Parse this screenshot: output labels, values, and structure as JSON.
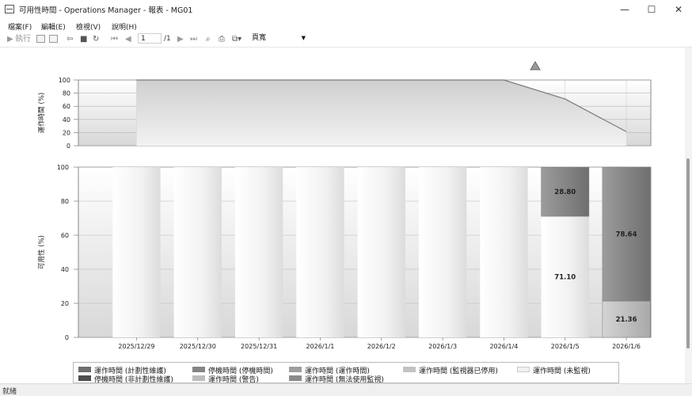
{
  "window": {
    "title": "可用性時間 - Operations Manager - 報表 - MG01",
    "minimize": "—",
    "maximize": "☐",
    "close": "✕"
  },
  "menu": {
    "items": [
      "檔案(F)",
      "編輯(E)",
      "檢視(V)",
      "說明(H)"
    ]
  },
  "toolbar": {
    "run_label": "執行",
    "page_current": "1",
    "page_total": "/1",
    "zoom": "頁寬"
  },
  "status": {
    "text": "就緒"
  },
  "chart_data": [
    {
      "type": "area",
      "ylabel": "運作時間 (%)",
      "ylim": [
        0,
        100
      ],
      "yticks": [
        0,
        20,
        40,
        60,
        80,
        100
      ],
      "x": [
        "2025/12/29",
        "2025/12/30",
        "2025/12/31",
        "2026/1/1",
        "2026/1/2",
        "2026/1/3",
        "2026/1/4",
        "2026/1/5",
        "2026/1/6"
      ],
      "values": [
        100,
        100,
        100,
        100,
        100,
        100,
        100,
        71.1,
        21.36
      ],
      "grid": true
    },
    {
      "type": "bar",
      "stacked": true,
      "ylabel": "可用性 (%)",
      "ylim": [
        0,
        100
      ],
      "yticks": [
        0,
        20,
        40,
        60,
        80,
        100
      ],
      "categories": [
        "2025/12/29",
        "2025/12/30",
        "2025/12/31",
        "2026/1/1",
        "2026/1/2",
        "2026/1/3",
        "2026/1/4",
        "2026/1/5",
        "2026/1/6"
      ],
      "series": [
        {
          "name": "運作時間 (運作時間)",
          "color": "#c2c2c2",
          "values": [
            0,
            0,
            0,
            0,
            0,
            0,
            0,
            0,
            21.36
          ],
          "labels": [
            "",
            "",
            "",
            "",
            "",
            "",
            "",
            "",
            "21.36"
          ]
        },
        {
          "name": "運作時間 (未監視)",
          "color": "#f5f5f5",
          "values": [
            100,
            100,
            100,
            100,
            100,
            100,
            100,
            71.1,
            0
          ],
          "labels": [
            "",
            "",
            "",
            "",
            "",
            "",
            "",
            "71.10",
            ""
          ]
        },
        {
          "name": "停機時間 (停機時間)",
          "color": "#858585",
          "values": [
            0,
            0,
            0,
            0,
            0,
            0,
            0,
            28.8,
            78.64
          ],
          "labels": [
            "",
            "",
            "",
            "",
            "",
            "",
            "",
            "28.80",
            "78.64"
          ]
        }
      ],
      "grid": true,
      "legend_position": "bottom"
    }
  ],
  "legend": [
    {
      "label": "運作時間 (計劃性維護)",
      "color": "#6e6e6e"
    },
    {
      "label": "停機時間 (停機時間)",
      "color": "#858585"
    },
    {
      "label": "運作時間 (運作時間)",
      "color": "#9e9e9e"
    },
    {
      "label": "運作時間 (監視器已停用)",
      "color": "#c2c2c2"
    },
    {
      "label": "運作時間 (未監視)",
      "color": "#f0f0f0"
    },
    {
      "label": "停機時間 (非計劃性維護)",
      "color": "#4f4f4f"
    },
    {
      "label": "運作時間 (警告)",
      "color": "#bdbdbd"
    },
    {
      "label": "運作時間 (無法使用監視)",
      "color": "#8a8a8a"
    }
  ]
}
